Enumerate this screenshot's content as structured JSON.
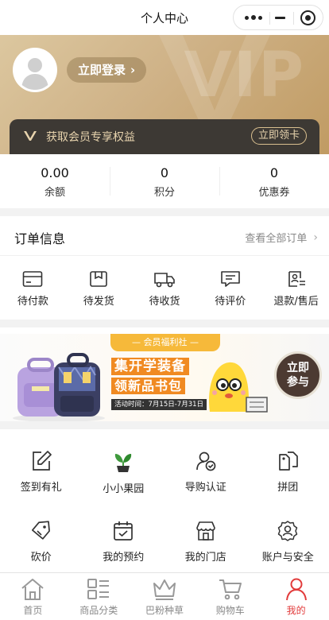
{
  "nav": {
    "title": "个人中心"
  },
  "profile": {
    "login_label": "立即登录",
    "vip_mark": "VIP",
    "vip_text": "获取会员专享权益",
    "vip_claim_label": "立即领卡"
  },
  "stats": [
    {
      "value": "0.00",
      "label": "余额"
    },
    {
      "value": "0",
      "label": "积分"
    },
    {
      "value": "0",
      "label": "优惠券"
    }
  ],
  "orders": {
    "title": "订单信息",
    "view_all": "查看全部订单",
    "items": [
      {
        "label": "待付款",
        "icon": "card-icon"
      },
      {
        "label": "待发货",
        "icon": "package-icon"
      },
      {
        "label": "待收货",
        "icon": "truck-icon"
      },
      {
        "label": "待评价",
        "icon": "comment-icon"
      },
      {
        "label": "退款/售后",
        "icon": "refund-icon"
      }
    ]
  },
  "banner": {
    "ribbon": "会员福利社",
    "line1": "集开学装备",
    "line2": "领新品书包",
    "date": "活动时间：7月15日-7月31日",
    "join": [
      "立即",
      "参与"
    ]
  },
  "services": {
    "row1": [
      {
        "label": "签到有礼",
        "icon": "edit-icon"
      },
      {
        "label": "小小果园",
        "icon": "plant-icon"
      },
      {
        "label": "导购认证",
        "icon": "user-verify-icon"
      },
      {
        "label": "拼团",
        "icon": "tags-icon"
      }
    ],
    "row2": [
      {
        "label": "砍价",
        "icon": "price-tag-icon"
      },
      {
        "label": "我的预约",
        "icon": "calendar-icon"
      },
      {
        "label": "我的门店",
        "icon": "store-icon"
      },
      {
        "label": "账户与安全",
        "icon": "settings-user-icon"
      }
    ]
  },
  "tabbar": [
    {
      "label": "首页",
      "icon": "home-icon"
    },
    {
      "label": "商品分类",
      "icon": "category-icon"
    },
    {
      "label": "巴粉种草",
      "icon": "crown-icon"
    },
    {
      "label": "购物车",
      "icon": "cart-icon"
    },
    {
      "label": "我的",
      "icon": "person-icon",
      "active": true
    }
  ],
  "colors": {
    "accent": "#e23b3b",
    "gold": "#cfb287",
    "vip_bar": "#3d3934",
    "promo_orange": "#f08a22"
  }
}
